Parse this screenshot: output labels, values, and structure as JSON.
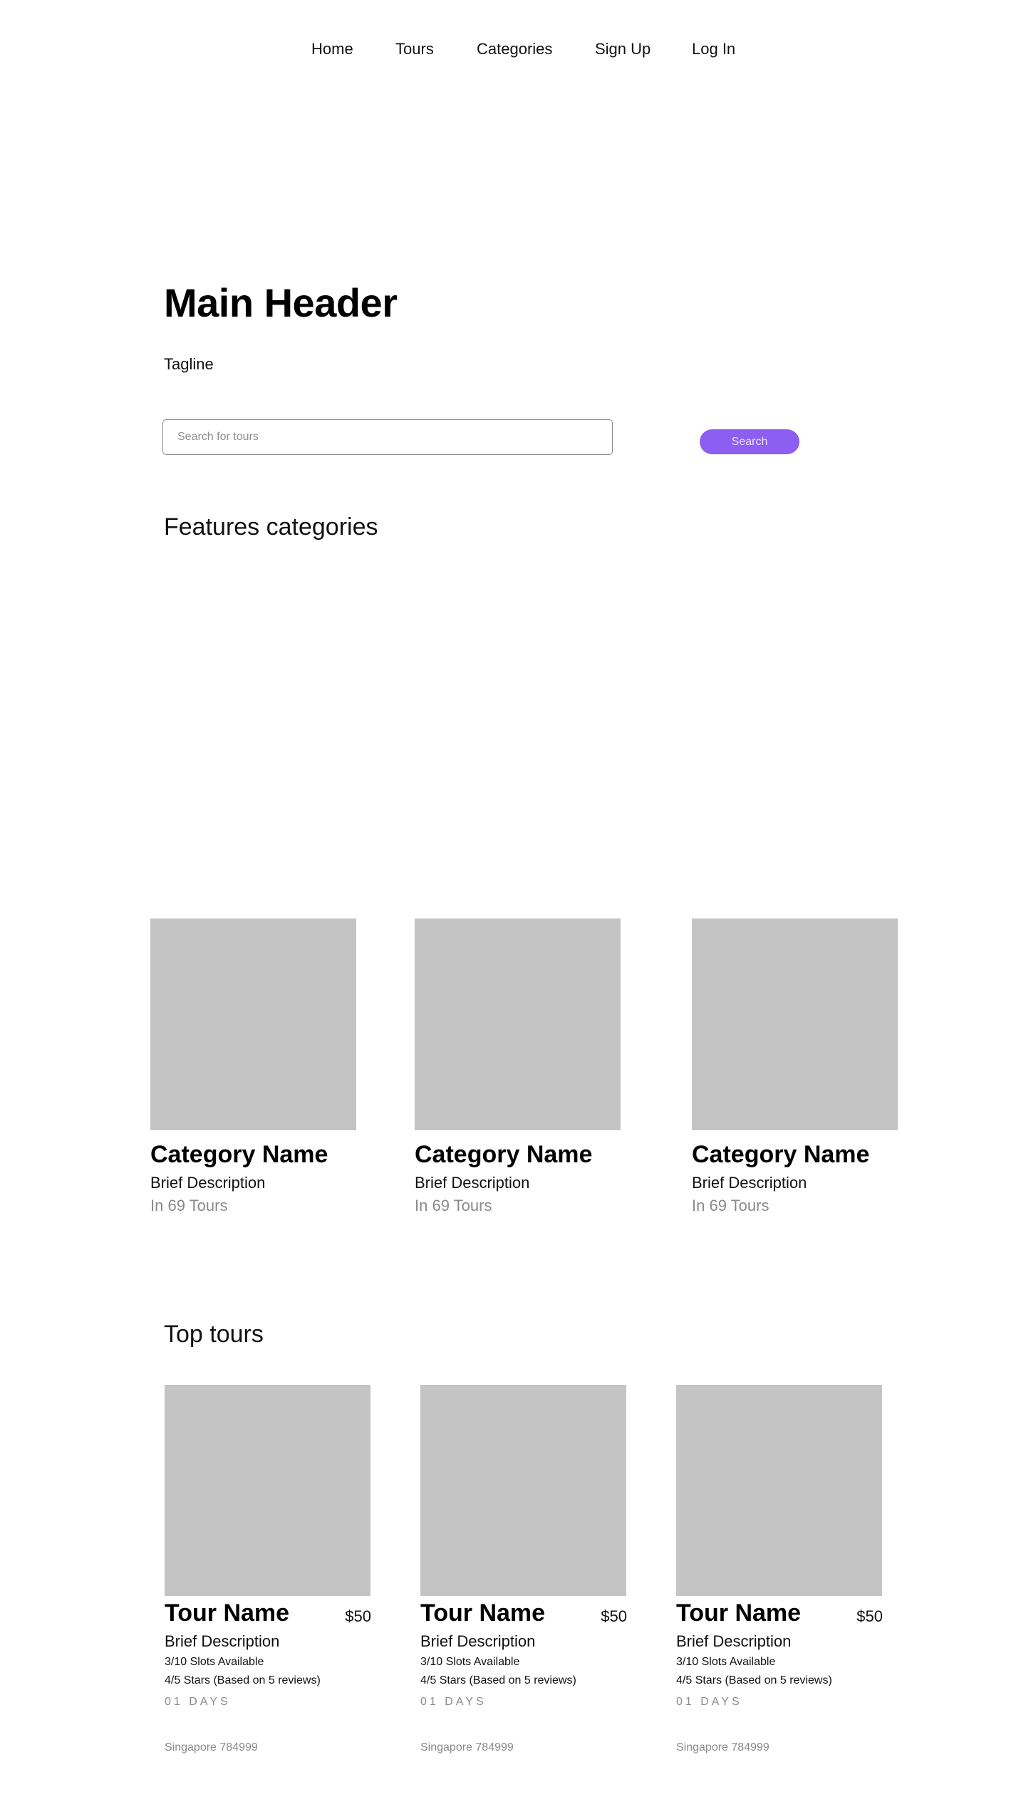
{
  "nav": {
    "items": [
      "Home",
      "Tours",
      "Categories",
      "Sign Up",
      "Log In"
    ]
  },
  "hero": {
    "title": "Main Header",
    "tagline": "Tagline"
  },
  "search": {
    "placeholder": "Search for tours",
    "value": "",
    "button_label": "Search"
  },
  "colors": {
    "accent": "#8d5ef2",
    "placeholder_gray": "#c4c4c4",
    "muted_text": "#8a8a8a"
  },
  "features": {
    "title": "Features categories",
    "categories": [
      {
        "name": "Category Name",
        "description": "Brief Description",
        "count": "In 69 Tours"
      },
      {
        "name": "Category Name",
        "description": "Brief Description",
        "count": "In 69 Tours"
      },
      {
        "name": "Category Name",
        "description": "Brief Description",
        "count": "In 69 Tours"
      }
    ]
  },
  "top_tours": {
    "title": "Top tours",
    "tours": [
      {
        "name": "Tour Name",
        "price": "$50",
        "description": "Brief Description",
        "slots": "3/10 Slots Available",
        "stars": "4/5 Stars (Based on 5 reviews)",
        "duration": "01 DAYS",
        "location": "Singapore 784999"
      },
      {
        "name": "Tour Name",
        "price": "$50",
        "description": "Brief Description",
        "slots": "3/10 Slots Available",
        "stars": "4/5 Stars (Based on 5 reviews)",
        "duration": "01 DAYS",
        "location": "Singapore 784999"
      },
      {
        "name": "Tour Name",
        "price": "$50",
        "description": "Brief Description",
        "slots": "3/10 Slots Available",
        "stars": "4/5 Stars (Based on 5 reviews)",
        "duration": "01 DAYS",
        "location": "Singapore 784999"
      }
    ]
  }
}
